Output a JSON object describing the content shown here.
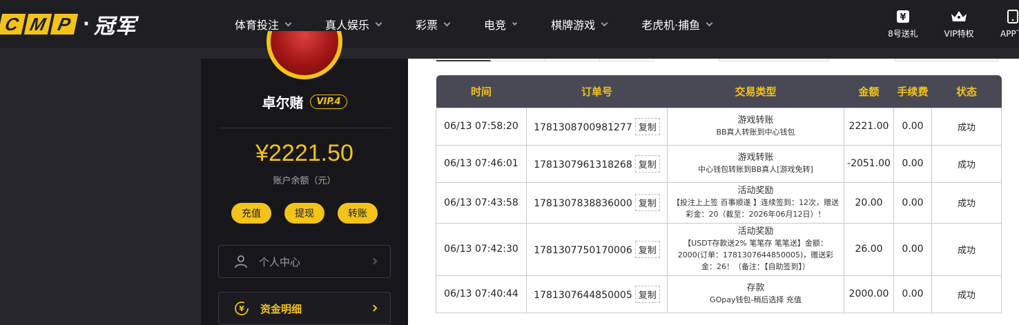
{
  "header": {
    "logo_letters": [
      "C",
      "M",
      "P"
    ],
    "logo_cn": "冠军",
    "nav": [
      {
        "label": "体育投注"
      },
      {
        "label": "真人娱乐"
      },
      {
        "label": "彩票"
      },
      {
        "label": "电竞"
      },
      {
        "label": "棋牌游戏"
      },
      {
        "label": "老虎机·捕鱼"
      }
    ],
    "quick": [
      {
        "label": "8号送礼",
        "icon": "yen-gift-icon"
      },
      {
        "label": "VIP特权",
        "icon": "crown-icon"
      },
      {
        "label": "APP下载",
        "icon": "mobile-app-icon"
      }
    ]
  },
  "profile": {
    "username": "卓尔赌",
    "vip": "VIP.4",
    "balance": "¥2221.50",
    "balance_label": "账户余额（元）",
    "actions": [
      "充值",
      "提现",
      "转账"
    ],
    "menu": {
      "personal": "个人中心",
      "funds": "资金明细"
    }
  },
  "colors": {
    "accent": "#f3c319",
    "header_bg": "#1e1e23",
    "table_head_bg": "#494955",
    "success": "#2e9b2e"
  },
  "table": {
    "headers": [
      "时间",
      "订单号",
      "交易类型",
      "金额",
      "手续费",
      "状态"
    ],
    "copy_label": "复制",
    "rows": [
      {
        "time": "06/13 07:58:20",
        "order": "1781308700981277",
        "type_title": "游戏转账",
        "type_desc": "BB真人转账到中心钱包",
        "amount": "2221.00",
        "fee": "0.00",
        "status": "成功"
      },
      {
        "time": "06/13 07:46:01",
        "order": "1781307961318268",
        "type_title": "游戏转账",
        "type_desc": "中心钱包转账到BB真人[游戏免转]",
        "amount": "-2051.00",
        "fee": "0.00",
        "status": "成功"
      },
      {
        "time": "06/13 07:43:58",
        "order": "1781307838836000",
        "type_title": "活动奖励",
        "type_desc": "【投注上上签 百事顺遂 】连续签到：12次，赠送彩金：20（截至：2026年06月12日）！",
        "amount": "20.00",
        "fee": "0.00",
        "status": "成功"
      },
      {
        "time": "06/13 07:42:30",
        "order": "1781307750170006",
        "type_title": "活动奖励",
        "type_desc": "【USDT存款送2% 笔笔存 笔笔送】金额：2000(订单：1781307644850005)，赠送彩金：26！（备注：【自助签到】）",
        "amount": "26.00",
        "fee": "0.00",
        "status": "成功"
      },
      {
        "time": "06/13 07:40:44",
        "order": "1781307644850005",
        "type_title": "存款",
        "type_desc": "GOpay钱包-稍后选择 充值",
        "amount": "2000.00",
        "fee": "0.00",
        "status": "成功"
      }
    ]
  }
}
